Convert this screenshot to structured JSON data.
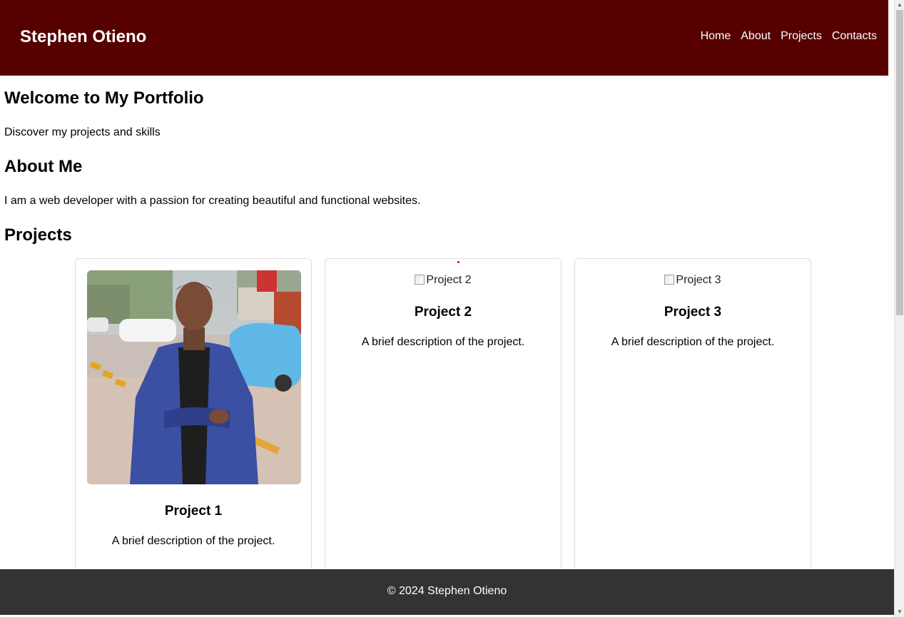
{
  "header": {
    "brand": "Stephen Otieno",
    "nav": [
      "Home",
      "About",
      "Projects",
      "Contacts"
    ],
    "background": "#560000"
  },
  "welcome": {
    "title": "Welcome to My Portfolio",
    "subtitle": "Discover my projects and skills"
  },
  "about": {
    "title": "About Me",
    "text": "I am a web developer with a passion for creating beautiful and functional websites."
  },
  "projects": {
    "title": "Projects",
    "items": [
      {
        "image_alt": "Project 1",
        "image_loaded": true,
        "title": "Project 1",
        "description": "A brief description of the project."
      },
      {
        "image_alt": "Project 2",
        "image_loaded": false,
        "title": "Project 2",
        "description": "A brief description of the project."
      },
      {
        "image_alt": "Project 3",
        "image_loaded": false,
        "title": "Project 3",
        "description": "A brief description of the project."
      }
    ]
  },
  "footer": {
    "text": "© 2024 Stephen Otieno",
    "background": "#333333"
  }
}
